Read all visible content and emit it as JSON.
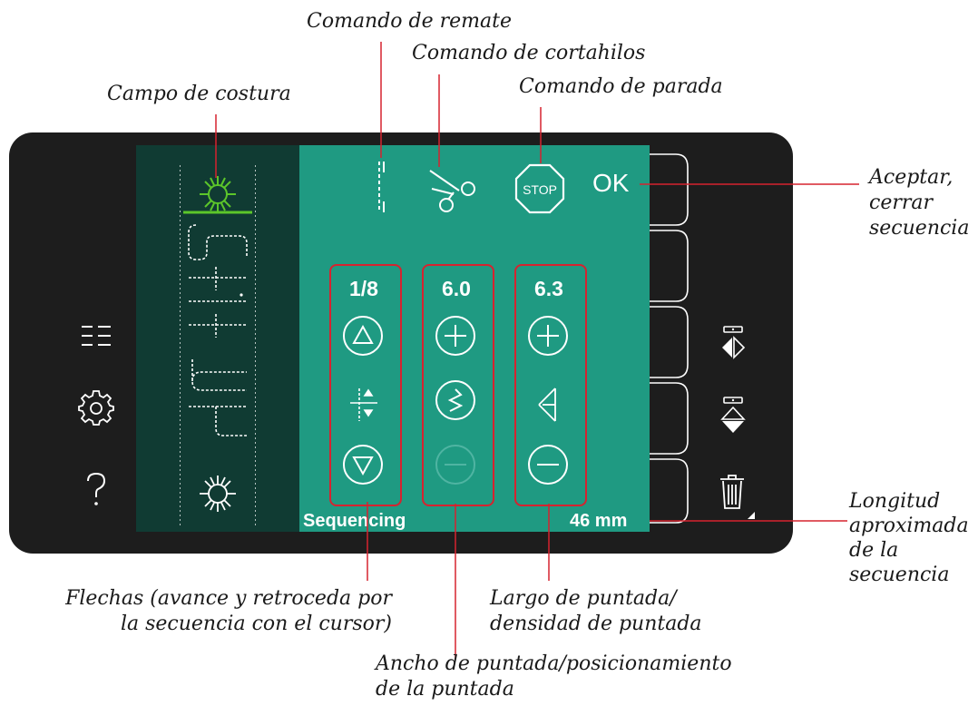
{
  "callouts": {
    "remate": "Comando de remate",
    "cortahilos": "Comando de cortahilos",
    "parada": "Comando de parada",
    "campo": "Campo de costura",
    "aceptar_1": "Aceptar,",
    "aceptar_2": "cerrar",
    "aceptar_3": "secuencia",
    "longitud_1": "Longitud",
    "longitud_2": "aproximada",
    "longitud_3": "de la",
    "longitud_4": "secuencia",
    "flechas_1": "Flechas (avance y retroceda por",
    "flechas_2": "la secuencia con el cursor)",
    "largo_1": "Largo de puntada/",
    "largo_2": "densidad de puntada",
    "ancho_1": "Ancho de puntada/posicionamiento",
    "ancho_2": "de la puntada"
  },
  "screen": {
    "ok_label": "OK",
    "stop_label": "STOP",
    "status_left": "Sequencing",
    "status_right": "46 mm",
    "columns": [
      {
        "value": "1/8"
      },
      {
        "value": "6.0"
      },
      {
        "value": "6.3"
      }
    ]
  },
  "icons": {
    "left": [
      "menu-list-icon",
      "settings-gear-icon",
      "help-question-icon"
    ],
    "right": [
      "mirror-side-to-side-icon",
      "mirror-end-to-end-icon",
      "delete-trash-icon"
    ],
    "top": [
      "tie-off-icon",
      "thread-cut-scissors-icon",
      "stop-sign-icon"
    ]
  },
  "colors": {
    "screen": "#1f9a82",
    "seqfield": "#103b33",
    "device": "#1d1d1d",
    "callout_line": "#d6232f",
    "active_stitch": "#5cc62a"
  }
}
